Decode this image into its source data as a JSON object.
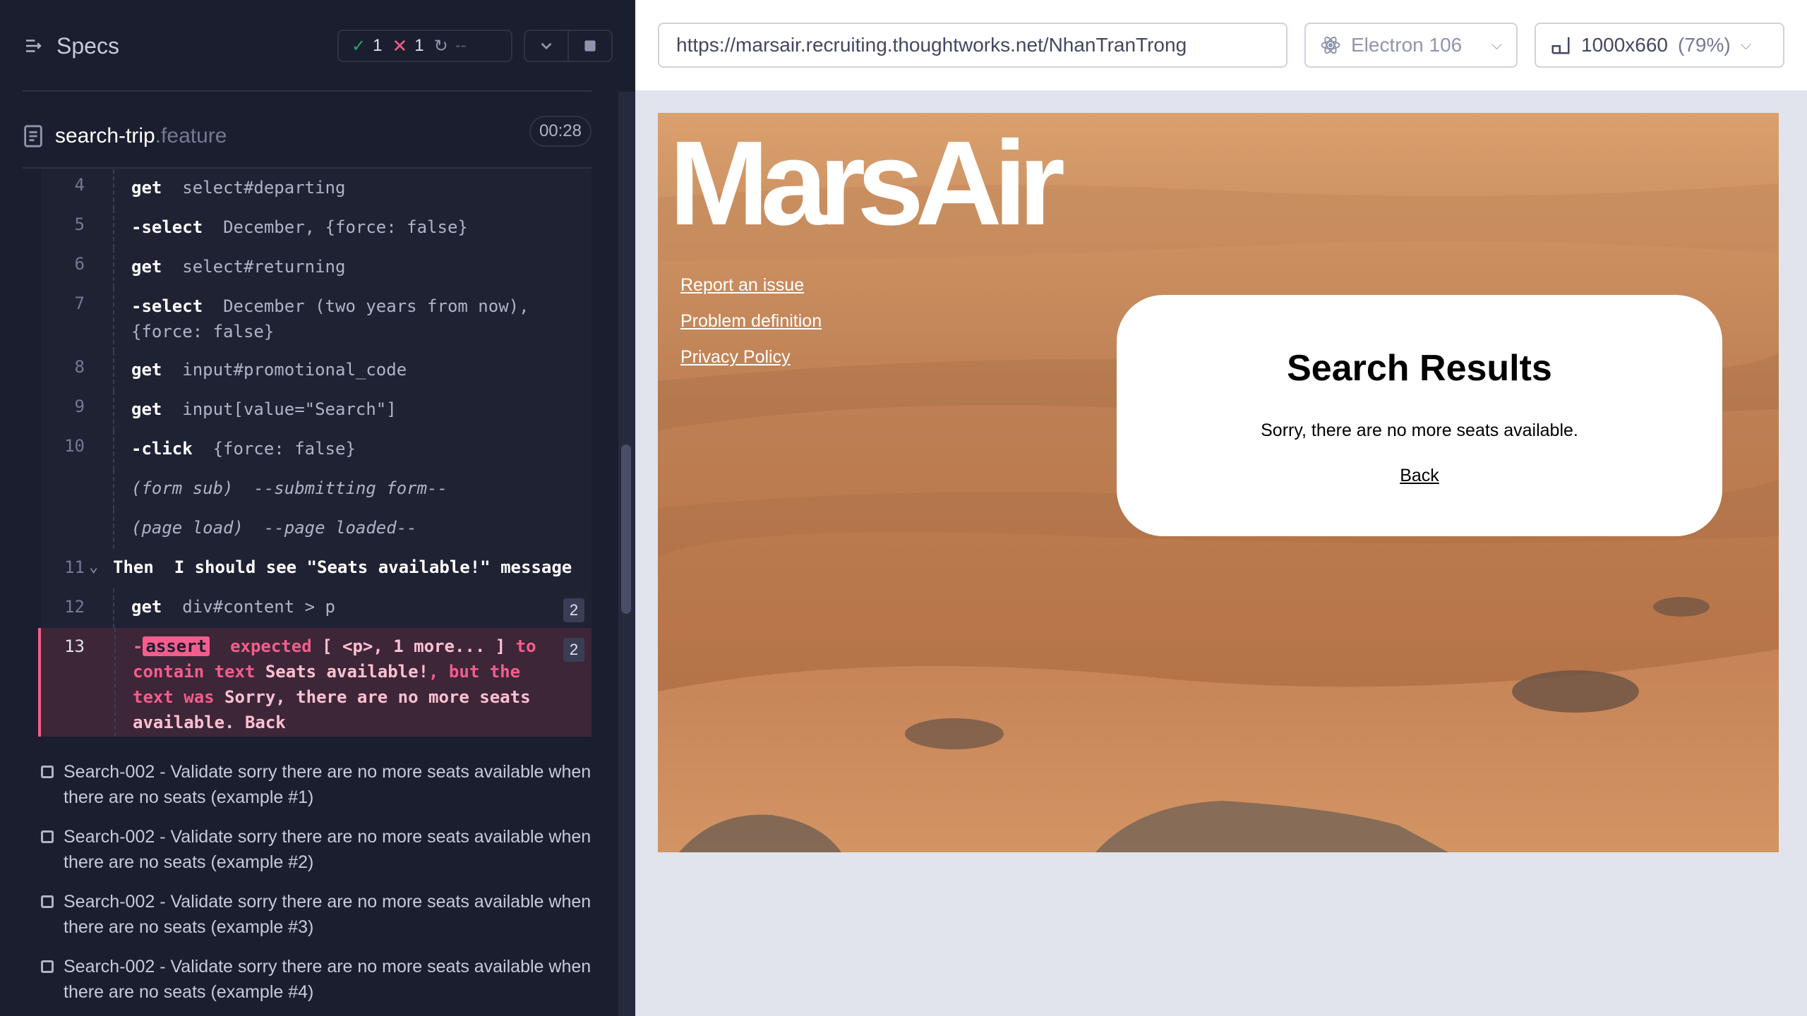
{
  "reporter": {
    "specs_label": "Specs",
    "stats": {
      "passed": "1",
      "failed": "1",
      "pending": "--"
    },
    "spec": {
      "name": "search-trip",
      "ext": ".feature",
      "duration": "00:28"
    },
    "commands": [
      {
        "line": "4",
        "name": "get",
        "args": "select#departing"
      },
      {
        "line": "5",
        "name": "-select",
        "args": "December, {force: false}"
      },
      {
        "line": "6",
        "name": "get",
        "args": "select#returning"
      },
      {
        "line": "7",
        "name": "-select",
        "args": "December (two years from now),",
        "args2": "{force: false}"
      },
      {
        "line": "8",
        "name": "get",
        "args": "input#promotional_code"
      },
      {
        "line": "9",
        "name": "get",
        "args": "input[value=\"Search\"]"
      },
      {
        "line": "10",
        "name": "-click",
        "args": "{force: false}"
      },
      {
        "line": "",
        "name": "(form sub)",
        "args": "--submitting form--"
      },
      {
        "line": "",
        "name": "(page load)",
        "args": "--page loaded--"
      },
      {
        "line": "11",
        "name": "Then",
        "args": "I should see \"Seats available!\" message"
      },
      {
        "line": "12",
        "name": "get",
        "args": "div#content > p",
        "badge": "2"
      },
      {
        "line": "13",
        "name": "assert",
        "badge": "2",
        "p1": "expected",
        "p2": "[ <p>, 1 more... ]",
        "p3": "to",
        "p4": "contain text",
        "p5": "Seats available!",
        "p6": ", but the",
        "p7": "text was",
        "p8": "Sorry, there are no more seats",
        "p9": "available. Back"
      }
    ],
    "tests": [
      "Search-002 - Validate sorry there are no more seats available when there are no seats (example #1)",
      "Search-002 - Validate sorry there are no more seats available when there are no seats (example #2)",
      "Search-002 - Validate sorry there are no more seats available when there are no seats (example #3)",
      "Search-002 - Validate sorry there are no more seats available when there are no seats (example #4)"
    ]
  },
  "aut": {
    "url": "https://marsair.recruiting.thoughtworks.net/NhanTranTrong",
    "browser": "Electron 106",
    "viewport": "1000x660",
    "viewport_pct": "(79%)",
    "page": {
      "logo": "MarsAir",
      "links": [
        "Report an issue",
        "Problem definition",
        "Privacy Policy"
      ],
      "results_title": "Search Results",
      "results_message": "Sorry, there are no more seats available.",
      "back_link": "Back"
    }
  },
  "colors": {
    "reporter_bg": "#1b1e2e",
    "pass": "#1fa971",
    "fail": "#f45d8c",
    "aut_bg": "#e1e3ed"
  },
  "icons": [
    "specs-toggle-icon",
    "check-icon",
    "x-icon",
    "spinner-icon",
    "chevron-down-icon",
    "stop-icon",
    "document-icon",
    "electron-icon",
    "viewport-icon"
  ]
}
